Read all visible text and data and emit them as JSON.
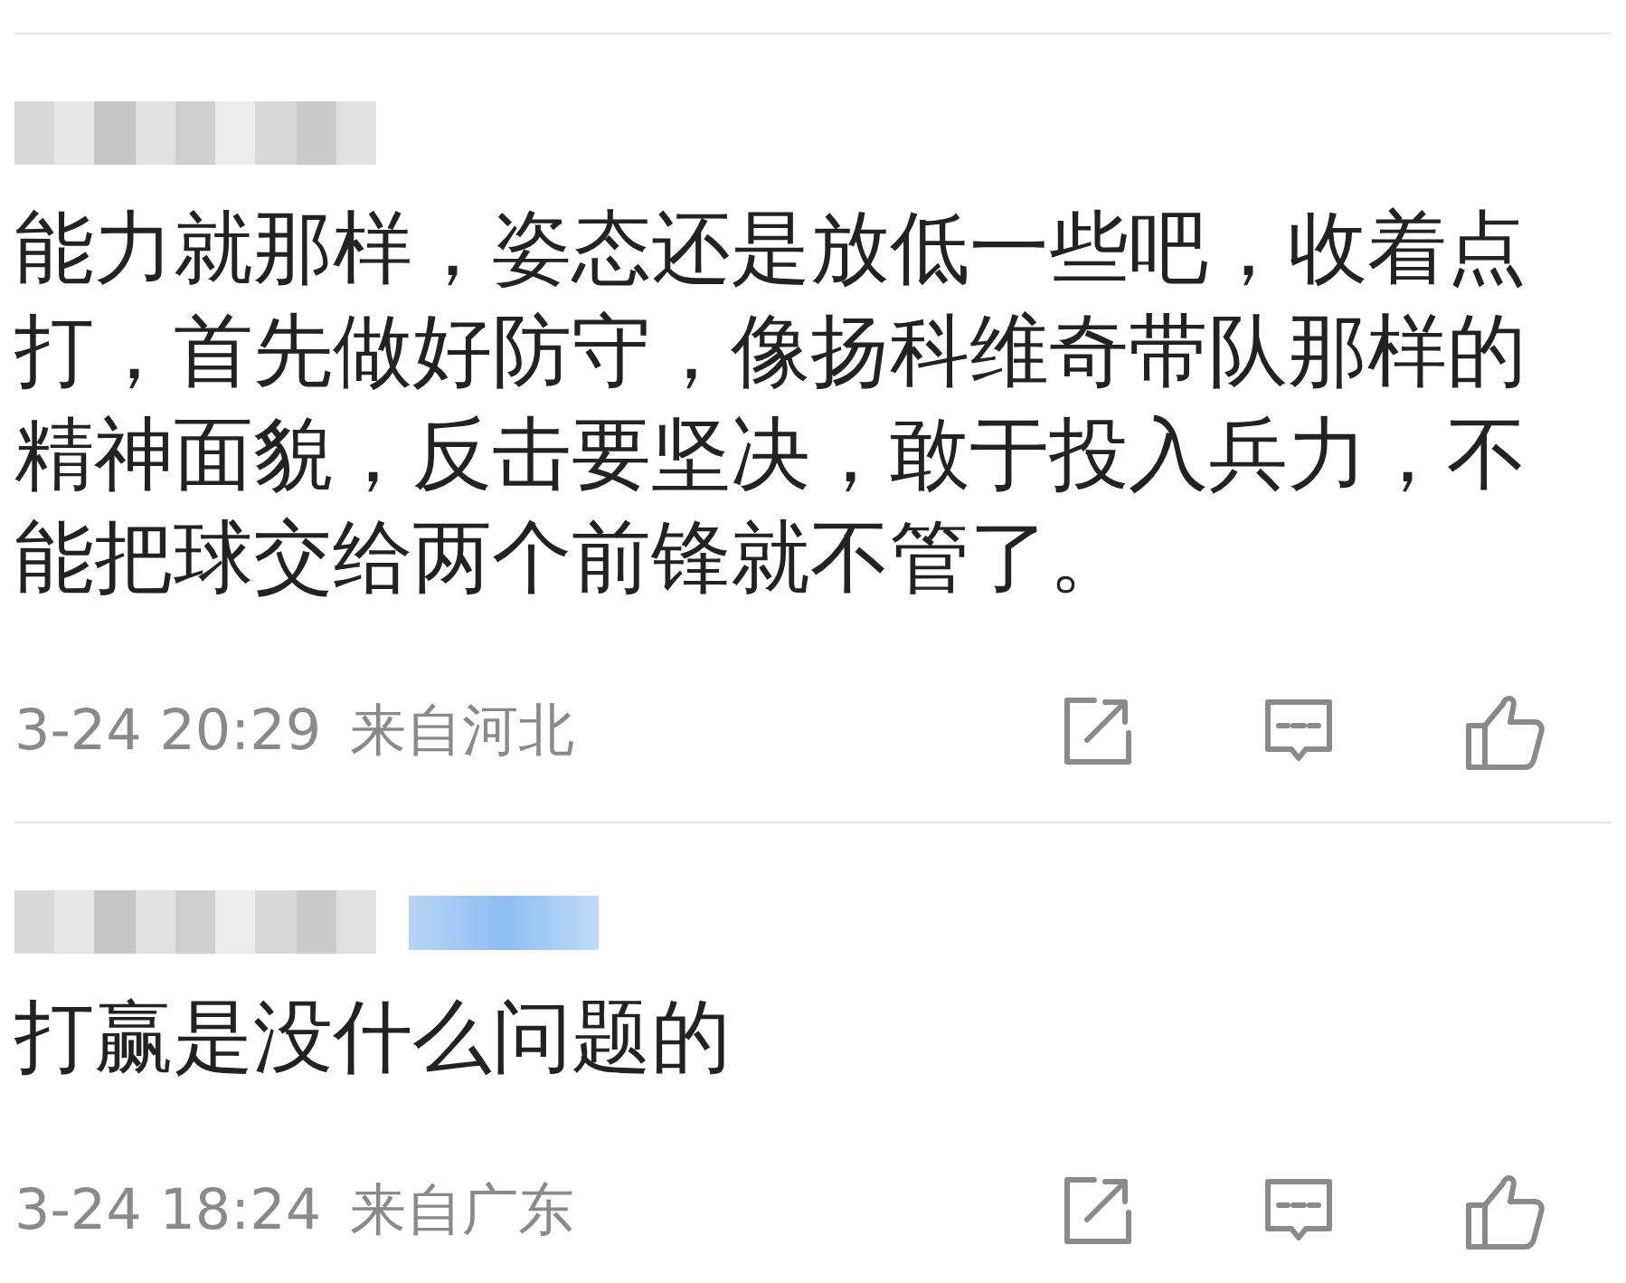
{
  "comments": [
    {
      "badge": false,
      "text": "能力就那样，姿态还是放低一些吧，收着点打，首先做好防守，像扬科维奇带队那样的精神面貌，反击要坚决，敢于投入兵力，不能把球交给两个前锋就不管了。",
      "time": "3-24 20:29",
      "location": "来自河北"
    },
    {
      "badge": true,
      "text": "打赢是没什么问题的",
      "time": "3-24 18:24",
      "location": "来自广东"
    }
  ]
}
